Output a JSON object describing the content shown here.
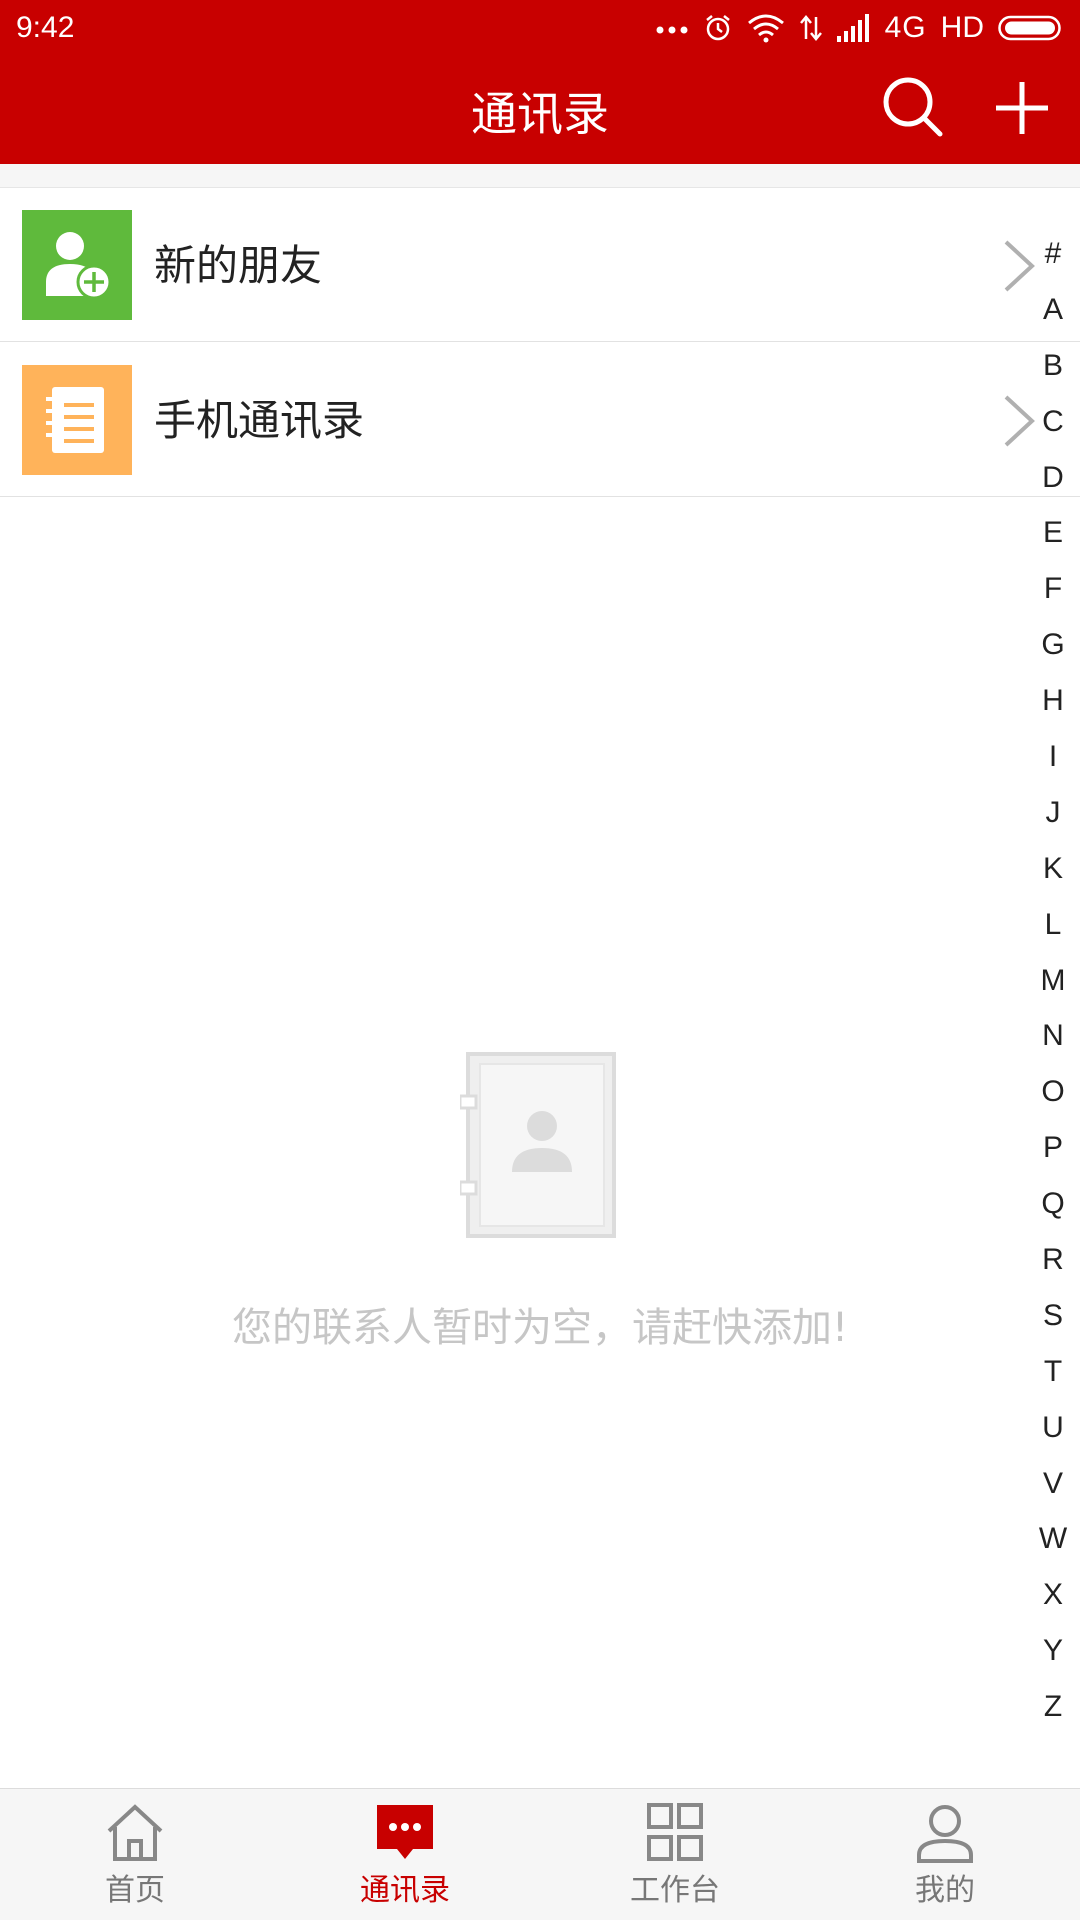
{
  "status_bar": {
    "time": "9:42",
    "network": "4G",
    "hd": "HD",
    "icons": [
      "more-dots-icon",
      "alarm-icon",
      "wifi-icon",
      "data-arrows-icon",
      "signal-icon",
      "battery-icon"
    ]
  },
  "header": {
    "title": "通讯录",
    "search_icon": "search-icon",
    "add_icon": "plus-icon"
  },
  "entries": [
    {
      "label": "新的朋友",
      "icon": "add-friend-icon",
      "icon_color": "#5fba3c"
    },
    {
      "label": "手机通讯录",
      "icon": "phone-contacts-icon",
      "icon_color": "#ffb35a"
    }
  ],
  "alphabet_index": [
    "#",
    "A",
    "B",
    "C",
    "D",
    "E",
    "F",
    "G",
    "H",
    "I",
    "J",
    "K",
    "L",
    "M",
    "N",
    "O",
    "P",
    "Q",
    "R",
    "S",
    "T",
    "U",
    "V",
    "W",
    "X",
    "Y",
    "Z"
  ],
  "empty_state": {
    "icon": "empty-contacts-icon",
    "message": "您的联系人暂时为空，请赶快添加!"
  },
  "tabs": [
    {
      "label": "首页",
      "icon": "home-icon",
      "active": false
    },
    {
      "label": "通讯录",
      "icon": "chat-bubble-icon",
      "active": true
    },
    {
      "label": "工作台",
      "icon": "grid-icon",
      "active": false
    },
    {
      "label": "我的",
      "icon": "person-icon",
      "active": false
    }
  ],
  "colors": {
    "brand_red": "#c80000",
    "inactive_gray": "#777777",
    "empty_text_gray": "#c6c6c6"
  }
}
